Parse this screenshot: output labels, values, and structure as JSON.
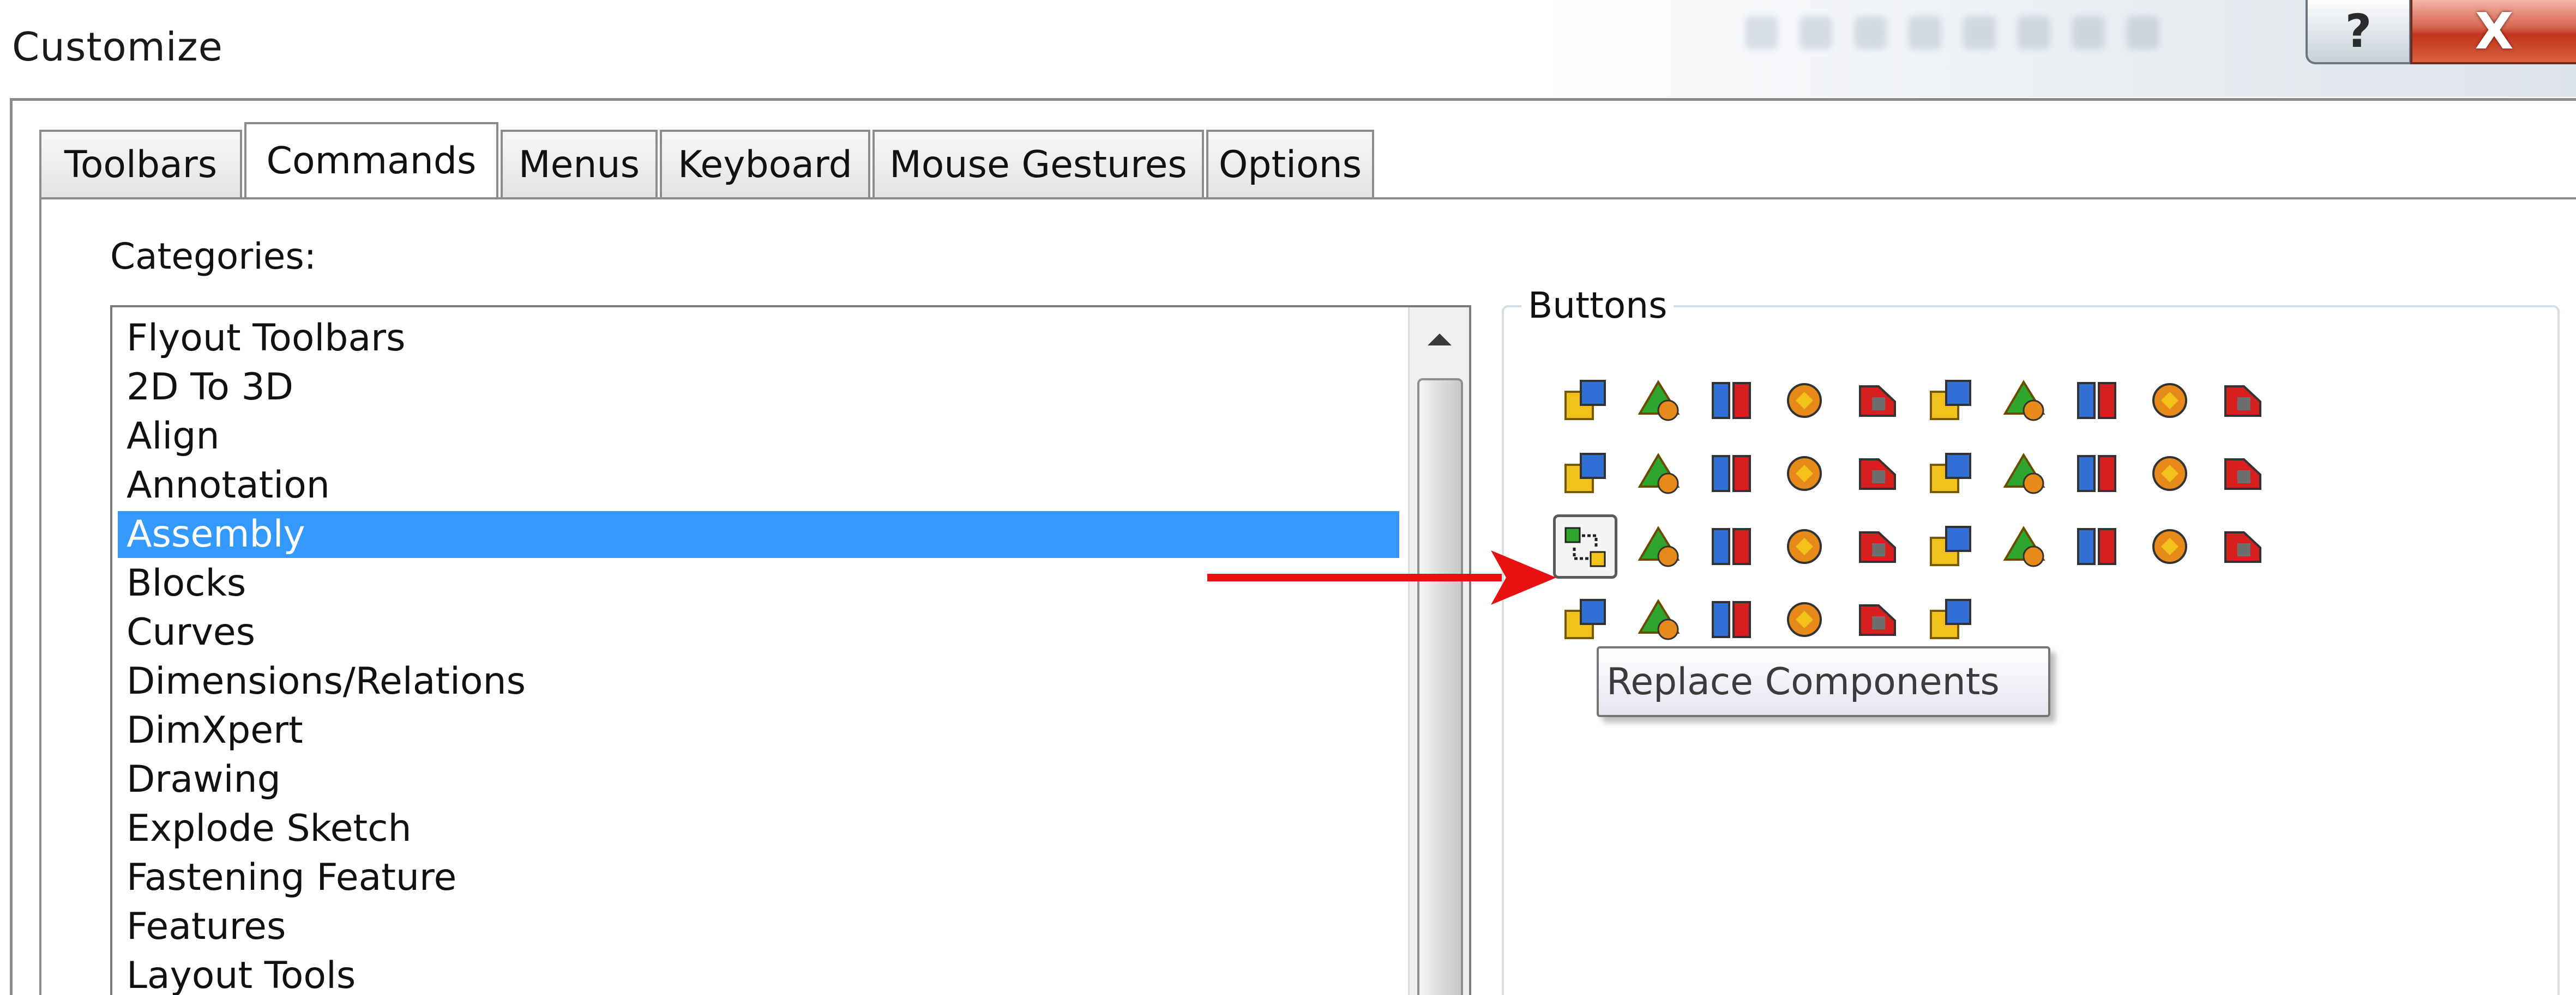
{
  "window": {
    "title": "Customize",
    "help_glyph": "?",
    "close_glyph": "X"
  },
  "tabs": [
    {
      "label": "Toolbars",
      "active": false
    },
    {
      "label": "Commands",
      "active": true
    },
    {
      "label": "Menus",
      "active": false
    },
    {
      "label": "Keyboard",
      "active": false
    },
    {
      "label": "Mouse Gestures",
      "active": false
    },
    {
      "label": "Options",
      "active": false
    }
  ],
  "categories": {
    "label": "Categories:",
    "selected": "Assembly",
    "items": [
      "Flyout Toolbars",
      "2D To 3D",
      "Align",
      "Annotation",
      "Assembly",
      "Blocks",
      "Curves",
      "Dimensions/Relations",
      "DimXpert",
      "Drawing",
      "Explode Sketch",
      "Fastening Feature",
      "Features",
      "Layout Tools"
    ]
  },
  "buttons_panel": {
    "legend": "Buttons",
    "hovered_tooltip": "Replace Components",
    "rows": [
      [
        "insert-components-icon",
        "new-part-icon",
        "new-assembly-icon",
        "copy-with-mates-icon",
        "mate-icon",
        "linear-pattern-icon",
        "smart-fasteners-icon",
        "mirror-components-icon",
        "move-component-icon",
        "rotate-component-icon"
      ],
      [
        "show-hidden-components-icon",
        "hide-components-icon",
        "change-transparency-icon",
        "edit-component-icon",
        "no-external-references-icon",
        "assembly-features-icon",
        "exploded-view-icon",
        "paperclip-icon",
        "interference-detection-icon",
        "refresh-icon"
      ],
      [
        "replace-components-icon",
        "pattern-driven-icon",
        "explode-line-sketch-icon",
        "smart-explode-line-icon",
        "collision-detection-icon",
        "align-components-icon",
        "clearance-verification-icon",
        "hole-alignment-icon",
        "assembly-visualization-icon",
        "sensor-icon"
      ],
      [
        "envelope-icon",
        "belt-chain-icon",
        "routing-icon",
        "make-subassembly-icon",
        "dissolve-subassembly-icon",
        "open-component-icon"
      ]
    ],
    "palette": {
      "yellow": "#f2c21b",
      "orange": "#e88a1a",
      "green": "#2ea62e",
      "blue": "#2f6fd6",
      "red": "#d71f1f",
      "gray": "#6e6e6e"
    }
  },
  "annotation": {
    "arrow_color": "#e81010"
  }
}
